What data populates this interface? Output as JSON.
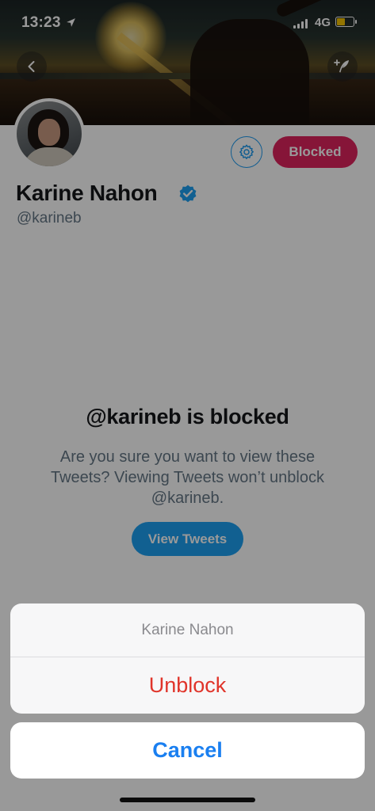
{
  "status_bar": {
    "time": "13:23",
    "network": "4G",
    "icons": [
      "location-arrow-icon",
      "signal-bars-icon",
      "battery-icon"
    ]
  },
  "header": {
    "icons": [
      "back-chevron-icon",
      "compose-tweet-icon"
    ]
  },
  "profile": {
    "name": "Karine Nahon",
    "handle": "@karineb",
    "blocked_button_label": "Blocked",
    "icons": [
      "gear-icon",
      "verified-badge-icon"
    ],
    "colors": {
      "blocked": "#e0245e",
      "accent": "#1da1f2"
    }
  },
  "blocked_notice": {
    "title": "@karineb is blocked",
    "message": "Are you sure you want to view these Tweets? Viewing Tweets won’t unblock @karineb.",
    "view_button_label": "View Tweets"
  },
  "action_sheet": {
    "title": "Karine Nahon",
    "action_label": "Unblock",
    "cancel_label": "Cancel",
    "colors": {
      "destructive": "#e0342a",
      "cancel": "#1a7ff0"
    }
  }
}
